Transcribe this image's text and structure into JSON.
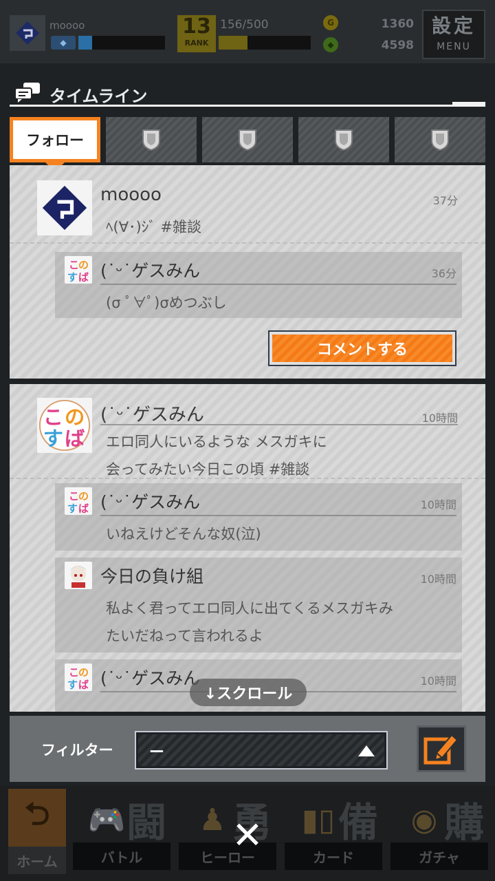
{
  "status": {
    "player_name": "moooo",
    "rank_number": "13",
    "rank_label": "RANK",
    "stamina_text": "156/500",
    "stamina_progress": 0.31,
    "exp_progress": 0.16,
    "currency_gold": "1360",
    "currency_green": "4598",
    "menu_kanji": "設定",
    "menu_label": "MENU"
  },
  "timeline": {
    "title": "タイムライン"
  },
  "tabs": [
    {
      "label": "フォロー",
      "active": true
    },
    {
      "label": "",
      "icon": "shield-icon"
    },
    {
      "label": "",
      "icon": "shield-icon"
    },
    {
      "label": "",
      "icon": "shield-icon"
    },
    {
      "label": "",
      "icon": "shield-icon"
    }
  ],
  "posts": [
    {
      "user": "moooo",
      "time": "37分",
      "text": "ﾍ(∀･)ｼﾞ #雑談",
      "replies": [
        {
          "user": "(˙ᵕ˙ゲスみん",
          "time": "36分",
          "text": "(σ ﾟ∀ﾟ)σめつぶし"
        }
      ],
      "comment_button": "コメントする"
    },
    {
      "user": "(˙ᵕ˙ゲスみん",
      "time": "10時間",
      "text_lines": [
        "エロ同人にいるような メスガキに",
        "会ってみたい今日この頃 #雑談"
      ],
      "replies": [
        {
          "user": "(˙ᵕ˙ゲスみん",
          "time": "10時間",
          "text": "いねえけどそんな奴(泣)"
        },
        {
          "user": "今日の負け組",
          "time": "10時間",
          "text_lines": [
            "私よく君ってエロ同人に出てくるメスガキみ",
            "たいだねって言われるよ"
          ]
        },
        {
          "user": "(˙ᵕ˙ゲスみん",
          "time": "10時間"
        }
      ]
    }
  ],
  "scroll_hint": "↓スクロール",
  "filter": {
    "label": "フィルター",
    "value": "ー"
  },
  "nav": [
    {
      "label": "ホーム"
    },
    {
      "label": "バトル",
      "kanji": "闘"
    },
    {
      "label": "ヒーロー",
      "kanji": "勇"
    },
    {
      "label": "カード",
      "kanji": "備"
    },
    {
      "label": "ガチャ",
      "kanji": "購"
    }
  ],
  "close_symbol": "✕",
  "colors": {
    "accent_orange": "#f58220",
    "background": "#1f2224",
    "post_bg": "#d4d4d4"
  }
}
